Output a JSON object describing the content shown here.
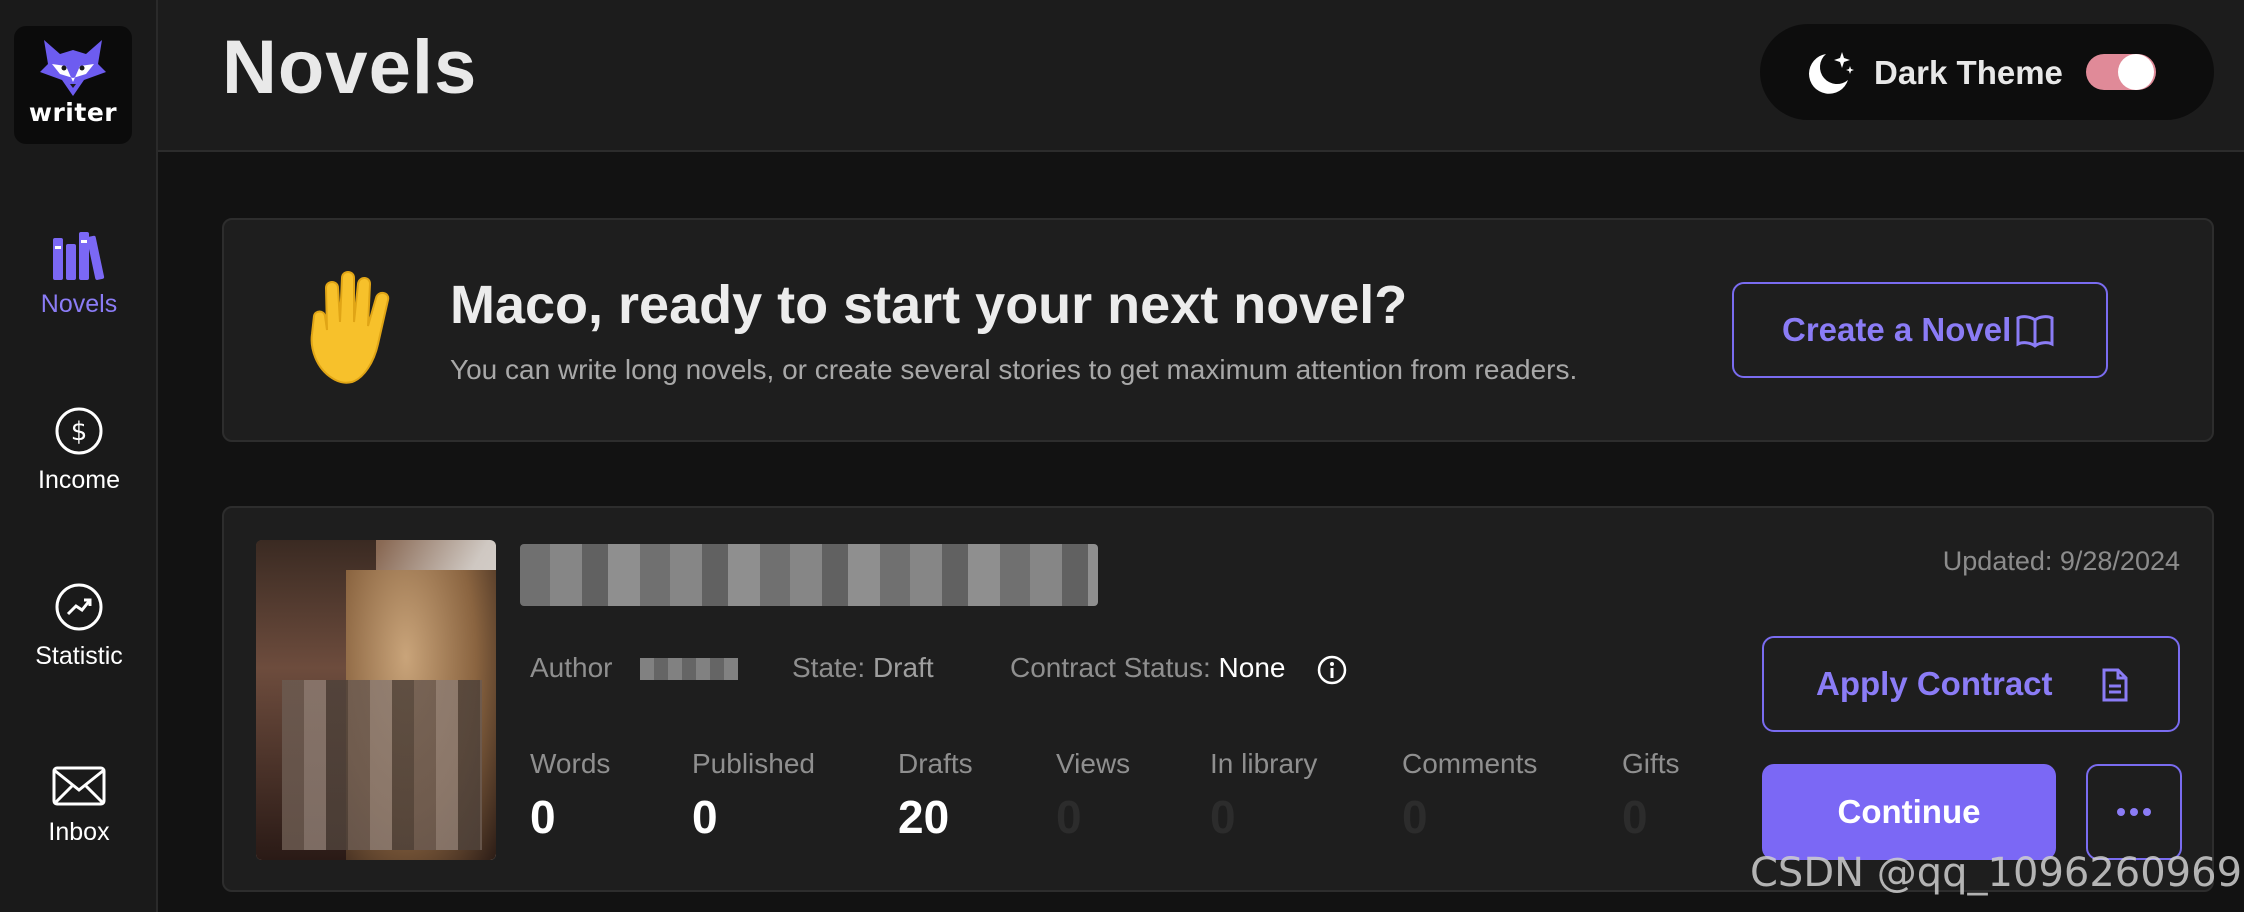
{
  "brand": {
    "logo_text": "writer",
    "logo_icon": "fox-icon"
  },
  "sidebar": {
    "items": [
      {
        "label": "Novels",
        "icon": "books-icon",
        "active": true
      },
      {
        "label": "Income",
        "icon": "dollar-circle-icon",
        "active": false
      },
      {
        "label": "Statistic",
        "icon": "chart-circle-icon",
        "active": false
      },
      {
        "label": "Inbox",
        "icon": "envelope-icon",
        "active": false
      }
    ]
  },
  "header": {
    "title": "Novels",
    "theme_label": "Dark Theme",
    "theme_icon": "moon-stars-icon",
    "dark_theme_on": true
  },
  "welcome": {
    "emoji_icon": "raised-hand-icon",
    "title": "Maco, ready to start your next novel?",
    "subtitle": "You can write long novels, or create several stories to get maximum attention from readers.",
    "create_label": "Create a Novel",
    "create_icon": "open-book-icon"
  },
  "novel": {
    "updated": "Updated: 9/28/2024",
    "author_label": "Author",
    "state_label": "State:",
    "state_value": "Draft",
    "contract_label": "Contract Status:",
    "contract_value": "None",
    "stats": [
      {
        "label": "Words",
        "value": "0",
        "dim": false
      },
      {
        "label": "Published",
        "value": "0",
        "dim": false
      },
      {
        "label": "Drafts",
        "value": "20",
        "dim": false
      },
      {
        "label": "Views",
        "value": "0",
        "dim": true
      },
      {
        "label": "In library",
        "value": "0",
        "dim": true
      },
      {
        "label": "Comments",
        "value": "0",
        "dim": true
      },
      {
        "label": "Gifts",
        "value": "0",
        "dim": true
      }
    ],
    "apply_label": "Apply Contract",
    "apply_icon": "document-icon",
    "continue_label": "Continue",
    "more_icon": "ellipsis-icon"
  },
  "colors": {
    "accent": "#7b68f5",
    "toggle_on": "#e08a98",
    "background": "#121212",
    "card": "#1e1e1e"
  },
  "watermark": "CSDN @qq_1096260969"
}
